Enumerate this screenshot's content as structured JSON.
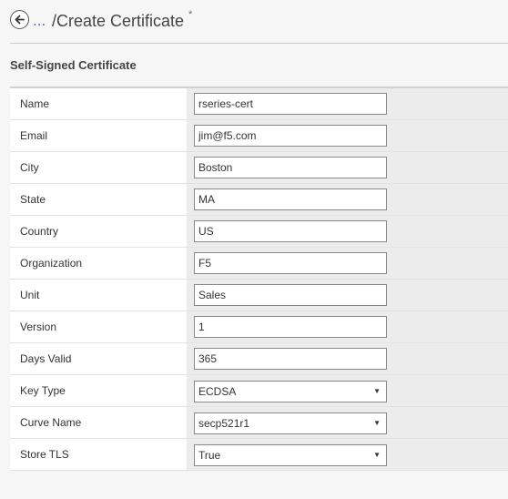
{
  "header": {
    "breadcrumb_ellipsis": "...",
    "title": "/Create Certificate",
    "required_mark": "*"
  },
  "section": {
    "title": "Self-Signed Certificate"
  },
  "fields": {
    "name": {
      "label": "Name",
      "value": "rseries-cert"
    },
    "email": {
      "label": "Email",
      "value": "jim@f5.com"
    },
    "city": {
      "label": "City",
      "value": "Boston"
    },
    "state": {
      "label": "State",
      "value": "MA"
    },
    "country": {
      "label": "Country",
      "value": "US"
    },
    "organization": {
      "label": "Organization",
      "value": "F5"
    },
    "unit": {
      "label": "Unit",
      "value": "Sales"
    },
    "version": {
      "label": "Version",
      "value": "1"
    },
    "days_valid": {
      "label": "Days Valid",
      "value": "365"
    },
    "key_type": {
      "label": "Key Type",
      "value": "ECDSA"
    },
    "curve_name": {
      "label": "Curve Name",
      "value": "secp521r1"
    },
    "store_tls": {
      "label": "Store TLS",
      "value": "True"
    }
  },
  "icons": {
    "back": "back-arrow-circle-icon",
    "dropdown": "caret-down-icon"
  },
  "colors": {
    "link": "#3a6fb8",
    "label_bg": "#ffffff",
    "value_bg": "#ececec",
    "page_bg": "#f6f6f6"
  }
}
